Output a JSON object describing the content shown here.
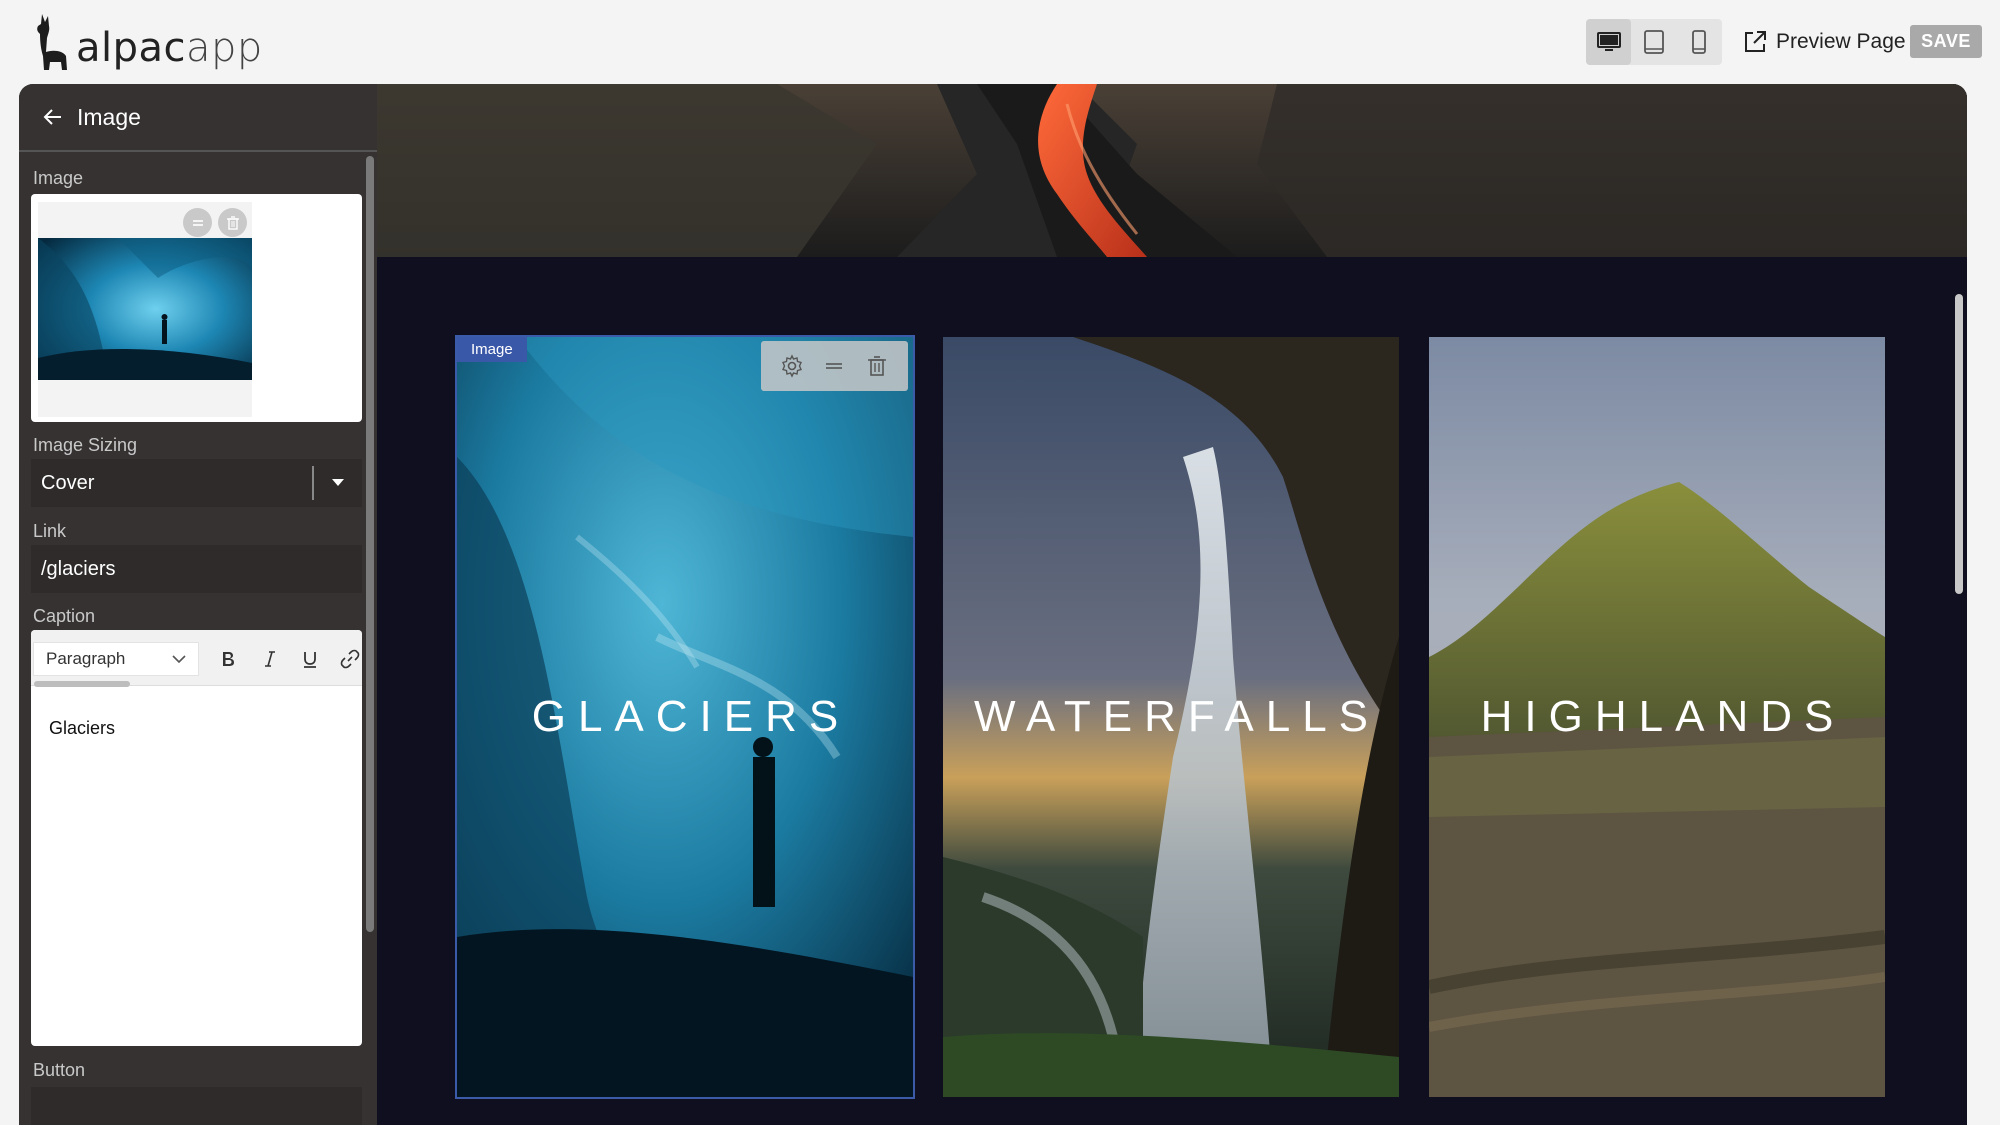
{
  "app": {
    "brand": "alpacapp",
    "brand_a": "alpac",
    "brand_b": "app"
  },
  "topbar": {
    "devices": [
      "desktop-icon",
      "tablet-icon",
      "mobile-icon"
    ],
    "active_device": "desktop",
    "preview_label": "Preview Page",
    "save_label": "SAVE"
  },
  "sidebar": {
    "title": "Image",
    "image_label": "Image",
    "image_sizing_label": "Image Sizing",
    "image_sizing_value": "Cover",
    "link_label": "Link",
    "link_value": "/glaciers",
    "caption_label": "Caption",
    "caption_format": "Paragraph",
    "caption_text": "Glaciers",
    "button_label": "Button"
  },
  "canvas": {
    "selected_tag": "Image",
    "cards": [
      {
        "title": "GLACIERS"
      },
      {
        "title": "WATERFALLS"
      },
      {
        "title": "HIGHLANDS"
      }
    ]
  },
  "colors": {
    "accent": "#3a58a8",
    "sidebar_bg": "#353231",
    "canvas_bg": "#0f0f1f",
    "save_bg": "#a9a9a9"
  }
}
